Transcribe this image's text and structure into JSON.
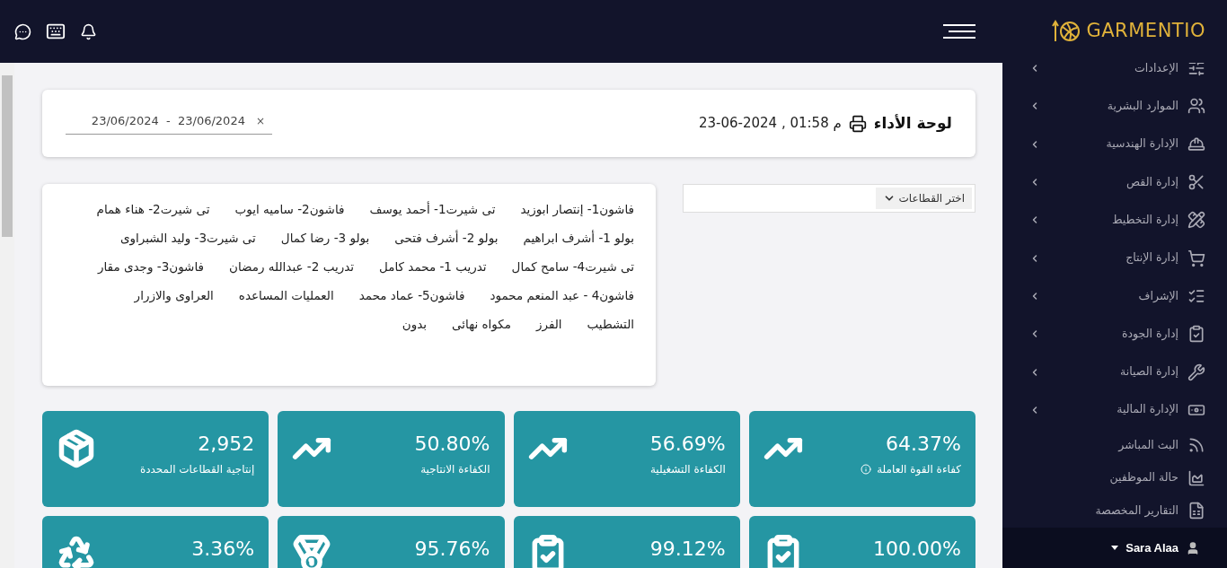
{
  "brand": "GARMENTIO",
  "user": {
    "name": "Sara Alaa"
  },
  "sidebar": {
    "items": [
      {
        "label": "الإعدادات",
        "has_submenu": true
      },
      {
        "label": "الموارد البشرية",
        "has_submenu": true
      },
      {
        "label": "الإدارة الهندسية",
        "has_submenu": true
      },
      {
        "label": "إدارة القص",
        "has_submenu": true
      },
      {
        "label": "إدارة التخطيط",
        "has_submenu": true
      },
      {
        "label": "إدارة الإنتاج",
        "has_submenu": true
      },
      {
        "label": "الإشراف",
        "has_submenu": true
      },
      {
        "label": "إدارة الجودة",
        "has_submenu": true
      },
      {
        "label": "إدارة الصيانة",
        "has_submenu": true
      },
      {
        "label": "الإدارة المالية",
        "has_submenu": true
      },
      {
        "label": "البث المباشر",
        "has_submenu": false
      },
      {
        "label": "حالة الموظفين",
        "has_submenu": false
      },
      {
        "label": "التقارير المخصصة",
        "has_submenu": false
      }
    ]
  },
  "page": {
    "title": "لوحة الأداء",
    "datetime": "23-06-2024 , 01:58 م",
    "date_range": "23/06/2024  -  23/06/2024",
    "clear": "×"
  },
  "sectors_select": {
    "label": "اختر القطاعات"
  },
  "sectors": [
    "فاشون1- إنتصار ابوزيد",
    "تى شيرت1- أحمد يوسف",
    "فاشون2- ساميه ايوب",
    "تى شيرت2- هناء همام",
    "بولو 1- أشرف ابراهيم",
    "بولو 2- أشرف فتحى",
    "بولو 3- رضا كمال",
    "تى شيرت3- وليد الشبراوى",
    "تى شيرت4- سامح كمال",
    "تدريب 1- محمد كامل",
    "تدريب 2- عبدالله رمضان",
    "فاشون3- وجدى مقار",
    "فاشون4 - عبد المنعم محمود",
    "فاشون5- عماد محمد",
    "العمليات المساعده",
    "العراوى والازرار",
    "التشطيب",
    "الفرز",
    "مكواه نهائى",
    "بدون"
  ],
  "stats": [
    {
      "value": "64.37%",
      "label": "كفاءة القوة العاملة"
    },
    {
      "value": "56.69%",
      "label": "الكفاءة التشغيلية"
    },
    {
      "value": "50.80%",
      "label": "الكفاءة الانتاجية"
    },
    {
      "value": "2,952",
      "label": "إنتاجية القطاعات المحددة"
    },
    {
      "value": "100.00%"
    },
    {
      "value": "99.12%"
    },
    {
      "value": "95.76%"
    },
    {
      "value": "3.36%"
    }
  ]
}
